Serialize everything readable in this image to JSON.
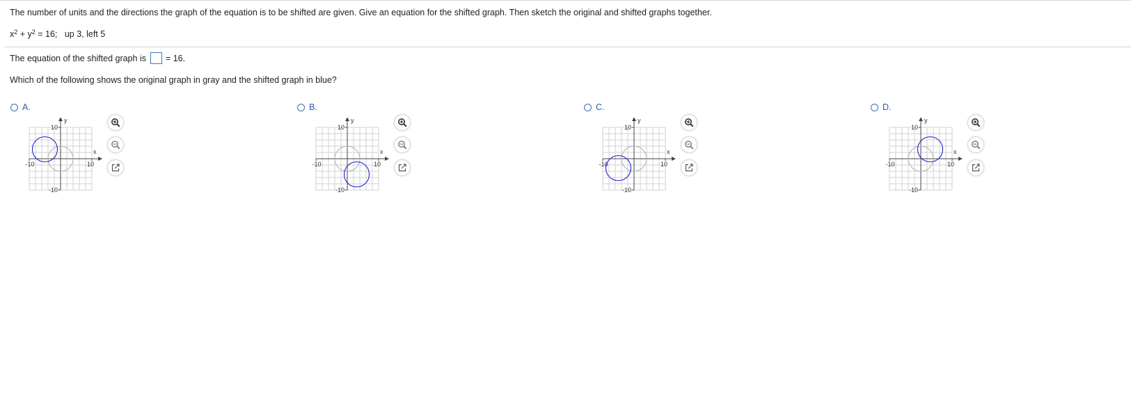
{
  "question": {
    "prompt": "The number of units and the directions the graph of the equation is to be shifted are given. Give an equation for the shifted graph. Then sketch the original and shifted graphs together.",
    "equation": {
      "x_base": "x",
      "x_exp": "2",
      "plus": " + ",
      "y_base": "y",
      "y_exp": "2",
      "rhs": " = 16;",
      "shift": "up 3, left 5"
    },
    "answer_prefix": "The equation of the shifted graph is ",
    "answer_value": "",
    "answer_suffix": " = 16.",
    "graph_question": "Which of the following shows the original graph in gray and the shifted graph in blue?"
  },
  "choices": [
    {
      "letter": "A.",
      "original_center": [
        0,
        0
      ],
      "shifted_center": [
        -5,
        3
      ],
      "radius": 4
    },
    {
      "letter": "B.",
      "original_center": [
        0,
        0
      ],
      "shifted_center": [
        3,
        -5
      ],
      "radius": 4
    },
    {
      "letter": "C.",
      "original_center": [
        0,
        0
      ],
      "shifted_center": [
        -5,
        -3
      ],
      "radius": 4
    },
    {
      "letter": "D.",
      "original_center": [
        0,
        0
      ],
      "shifted_center": [
        3,
        3
      ],
      "radius": 4
    }
  ],
  "axes": {
    "x_label": "x",
    "y_label": "y",
    "x_min_label": "-10",
    "x_max_label": "10",
    "y_max_label": "10",
    "y_min_label": "-10",
    "range": [
      -10,
      10
    ],
    "grid_step": 2
  },
  "tools": {
    "zoom_in": "zoom-in-icon",
    "zoom_out": "zoom-out-icon",
    "popout": "popout-icon"
  },
  "colors": {
    "original": "#b0b0b0",
    "shifted": "#1f1fd6",
    "grid": "#d2d2d2",
    "accent": "#2a5db0"
  }
}
